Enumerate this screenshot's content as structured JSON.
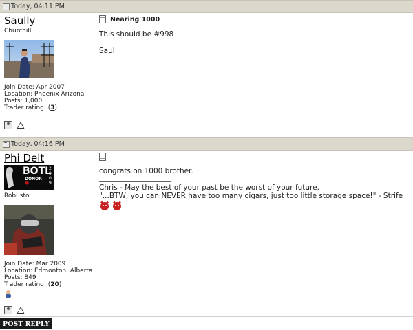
{
  "posts": [
    {
      "timestamp": "Today, 04:11 PM",
      "username": "Saully",
      "usertitle": "Churchill",
      "join_date": "Join Date: Apr 2007",
      "location": "Location: Phoenix Arizona",
      "posts": "Posts: 1,000",
      "trader_label": "Trader rating: (",
      "trader_value": "3",
      "trader_close": ")",
      "title": "Nearing 1000",
      "message": "This should be #998",
      "signature": [
        "Saul"
      ]
    },
    {
      "timestamp": "Today, 04:16 PM",
      "username": "Phi Delt",
      "usertitle": "Robusto",
      "badge_text": "BOTL",
      "badge_sub": "DONOR",
      "badge_year": "2009",
      "join_date": "Join Date: Mar 2009",
      "location": "Location: Edmonton, Alberta",
      "posts": "Posts: 849",
      "trader_label": "Trader rating: (",
      "trader_value": "20",
      "trader_close": ")",
      "title": "",
      "message": "congrats on 1000 brother.",
      "signature": [
        "Chris - May the best of your past be the worst of your future.",
        "\"...BTW, you can NEVER have too many cigars, just too little storage space!\" - Strife"
      ]
    }
  ],
  "post_reply_label": "POST REPLY",
  "colors": {
    "header_bg": "#dcd8cc",
    "button_bg": "#1a1a1a"
  }
}
